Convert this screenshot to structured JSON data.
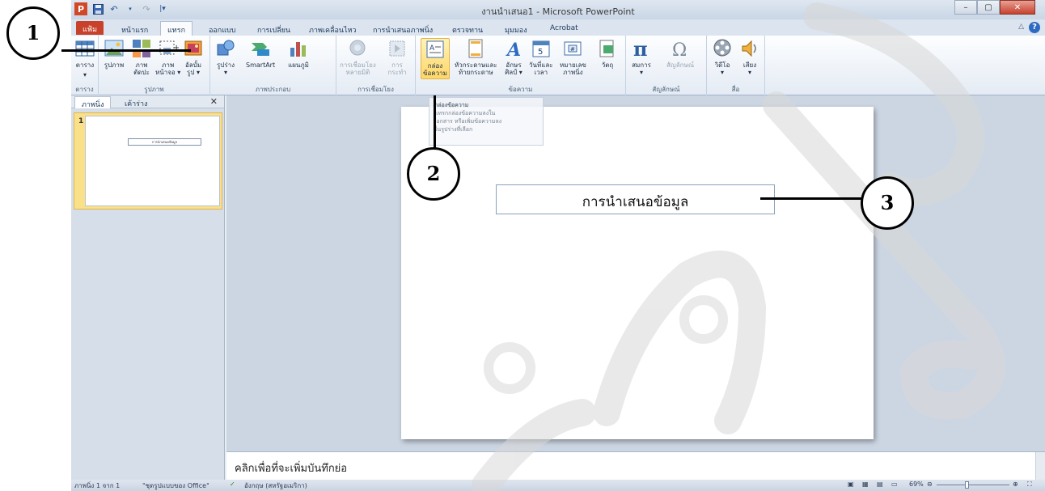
{
  "window": {
    "title": "งานนำเสนอ1 - Microsoft PowerPoint",
    "app_logo": "P",
    "qat_icons": [
      "save-icon",
      "undo-icon",
      "redo-icon",
      "customize-icon"
    ]
  },
  "tabs": [
    {
      "label": "แฟ้ม"
    },
    {
      "label": "หน้าแรก"
    },
    {
      "label": "แทรก"
    },
    {
      "label": "ออกแบบ"
    },
    {
      "label": "การเปลี่ยน"
    },
    {
      "label": "ภาพเคลื่อนไหว"
    },
    {
      "label": "การนำเสนอภาพนิ่ง"
    },
    {
      "label": "ตรวจทาน"
    },
    {
      "label": "มุมมอง"
    },
    {
      "label": "Acrobat"
    }
  ],
  "ribbon": {
    "groups": [
      {
        "label": "ตาราง"
      },
      {
        "label": "รูปภาพ"
      },
      {
        "label": "ภาพประกอบ"
      },
      {
        "label": "การเชื่อมโยง"
      },
      {
        "label": "ข้อความ"
      },
      {
        "label": "สัญลักษณ์"
      },
      {
        "label": "สื่อ"
      }
    ],
    "buttons": {
      "table": "ตาราง",
      "picture": "รูปภาพ",
      "clipart_1": "ภาพ",
      "clipart_2": "ตัดปะ",
      "screenshot_1": "ภาพ",
      "screenshot_2": "หน้าจอ ▾",
      "album_1": "อัลบั้ม",
      "album_2": "รูป ▾",
      "shapes": "รูปร่าง",
      "smartart": "SmartArt",
      "chart": "แผนภูมิ",
      "hyperlink_1": "การเชื่อมโยง",
      "hyperlink_2": "หลายมิติ",
      "action_1": "การ",
      "action_2": "กระทำ",
      "textbox_1": "กล่อง",
      "textbox_2": "ข้อความ",
      "header_1": "หัวกระดาษและ",
      "header_2": "ท้ายกระดาษ",
      "wordart_1": "อักษร",
      "wordart_2": "ศิลป์ ▾",
      "datetime_1": "วันที่และ",
      "datetime_2": "เวลา",
      "slidenum_1": "หมายเลข",
      "slidenum_2": "ภาพนิ่ง",
      "object": "วัตถุ",
      "equation": "สมการ",
      "symbol": "สัญลักษณ์",
      "video": "วิดีโอ",
      "audio": "เสียง"
    }
  },
  "tooltip": {
    "title": "กล่องข้อความ",
    "line1": "แทรกกล่องข้อความลงใน",
    "line2": "เอกสาร หรือเพิ่มข้อความลง",
    "line3": "ในรูปร่างที่เลือก"
  },
  "pane": {
    "tab_slides": "ภาพนิ่ง",
    "tab_outline": "เค้าร่าง",
    "close": "✕",
    "slide_number": "1",
    "thumb_text": "การนำเสนอข้อมูล"
  },
  "slide": {
    "textbox_text": "การนำเสนอข้อมูล"
  },
  "notes": {
    "placeholder": "คลิกเพื่อที่จะเพิ่มบันทึกย่อ"
  },
  "status": {
    "slide_info": "ภาพนิ่ง 1 จาก 1",
    "theme": "\"ชุดรูปแบบของ Office\"",
    "language": "อังกฤษ (สหรัฐอเมริกา)",
    "zoom": "69%"
  },
  "callouts": [
    "1",
    "2",
    "3"
  ]
}
